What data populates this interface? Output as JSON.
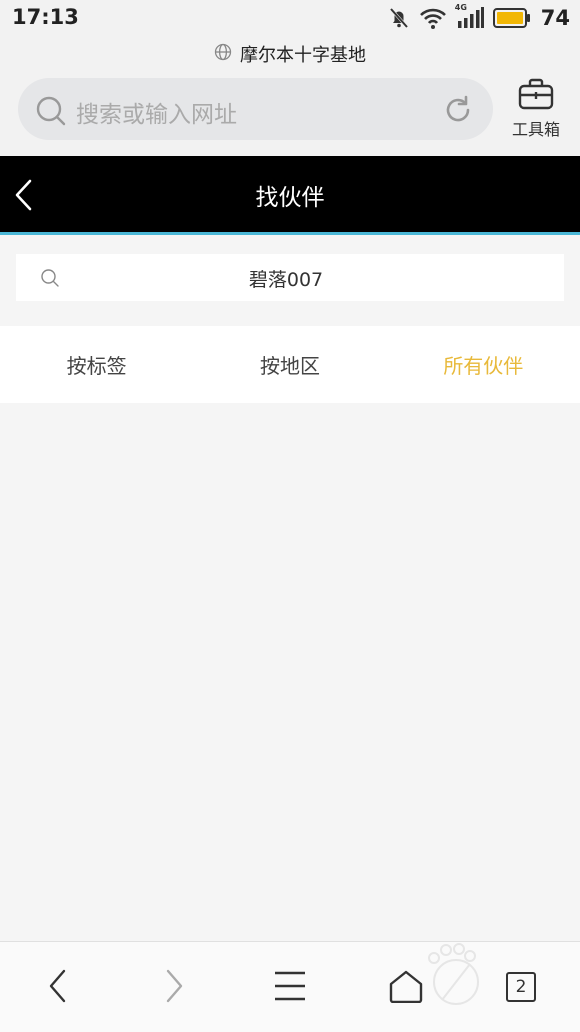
{
  "status_bar": {
    "time": "17:13",
    "network_label": "4G",
    "battery": "74",
    "icons": [
      "mute-bell-icon",
      "wifi-icon",
      "signal-icon",
      "battery-icon"
    ]
  },
  "browser": {
    "site_title": "摩尔本十字基地",
    "search_placeholder": "搜索或输入网址",
    "toolbox_label": "工具箱",
    "tab_count": "2"
  },
  "page": {
    "title": "找伙伴",
    "search_value": "碧落007",
    "tabs": [
      {
        "label": "按标签",
        "active": false
      },
      {
        "label": "按地区",
        "active": false
      },
      {
        "label": "所有伙伴",
        "active": true
      }
    ]
  },
  "colors": {
    "header_bg": "#000000",
    "header_accent": "#4ab7d6",
    "active_tab": "#e8b93a"
  }
}
